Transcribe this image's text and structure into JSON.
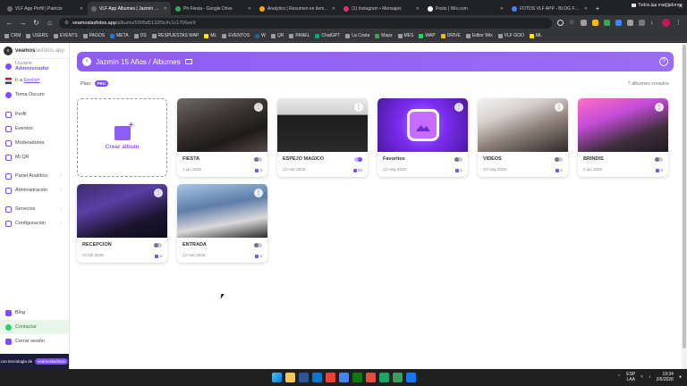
{
  "browser": {
    "tabs": [
      {
        "label": "VLF App Perfil | Patricio",
        "color": "#6b6b6b",
        "active": false
      },
      {
        "label": "VLF App Álbumes | Jazmín 15 A",
        "color": "#6b6b6b",
        "active": true
      },
      {
        "label": "Ph Fiesta - Google Drive",
        "color": "#34a853",
        "active": false
      },
      {
        "label": "Analytics | Resumen en tiempo",
        "color": "#f9ab00",
        "active": false
      },
      {
        "label": "(1) Instagram • Mensajes",
        "color": "#e1306c",
        "active": false
      },
      {
        "label": "Posts | Wix.com",
        "color": "#ffffff",
        "active": false
      },
      {
        "label": "FOTOS VLF APP - BLOG FORMA",
        "color": "#4285f4",
        "active": false
      }
    ],
    "url_host": "veamoslasfotos.app",
    "url_path": "/albums/5995d5132f9c4c1c1706ee9",
    "bookmarks": [
      {
        "label": "CRM",
        "color": "#9e9e9e"
      },
      {
        "label": "USERS",
        "color": "#9e9e9e"
      },
      {
        "label": "EVENTS",
        "color": "#9e9e9e"
      },
      {
        "label": "PAGOS",
        "color": "#9e9e9e"
      },
      {
        "label": "META",
        "color": "#1877f2"
      },
      {
        "label": "DS",
        "color": "#9e9e9e"
      },
      {
        "label": "RESPUESTAS WAP",
        "color": "#9e9e9e"
      },
      {
        "label": "ML",
        "color": "#ffe600"
      },
      {
        "label": "EVENTOS",
        "color": "#9e9e9e"
      },
      {
        "label": "W",
        "color": "#2b579a"
      },
      {
        "label": "QR",
        "color": "#9e9e9e"
      },
      {
        "label": "PANEL",
        "color": "#9e9e9e"
      },
      {
        "label": "ChatGPT",
        "color": "#10a37f"
      },
      {
        "label": "La Costa",
        "color": "#9e9e9e"
      },
      {
        "label": "Maps",
        "color": "#34a853"
      },
      {
        "label": "MES",
        "color": "#9e9e9e"
      },
      {
        "label": "WAP",
        "color": "#25d366"
      },
      {
        "label": "DRIVE",
        "color": "#fbbc04"
      },
      {
        "label": "Editor Wix",
        "color": "#9e9e9e"
      },
      {
        "label": "VLF GOO",
        "color": "#9e9e9e"
      },
      {
        "label": "ML",
        "color": "#ffe600"
      }
    ],
    "all_bookmarks": "Todos los marcadores"
  },
  "sidebar": {
    "logo": {
      "text1": "veamos",
      "text2": "lasfotos.app"
    },
    "user": {
      "prefix": "Usuario",
      "role": "Administrador"
    },
    "lang": {
      "prefix": "Ir a",
      "link": "Ennlish"
    },
    "theme": "Tema Oscuro",
    "items": [
      {
        "label": "Perfil",
        "icon": "user-icon"
      },
      {
        "label": "Eventos",
        "icon": "calendar-icon"
      },
      {
        "label": "Moderadores",
        "icon": "shield-icon"
      },
      {
        "label": "Mi QR",
        "icon": "qr-icon"
      },
      {
        "label": "Panel Analítico",
        "icon": "chart-icon"
      },
      {
        "label": "Administración",
        "icon": "admin-icon"
      },
      {
        "label": "Servicios",
        "icon": "services-icon"
      },
      {
        "label": "Configuración",
        "icon": "gear-icon"
      }
    ],
    "bottom": [
      {
        "label": "Blog",
        "icon": "blog-icon"
      },
      {
        "label": "Contactar",
        "icon": "whatsapp-icon"
      },
      {
        "label": "Cerrar sesión",
        "icon": "logout-icon"
      }
    ],
    "footer": {
      "left": "con tecnología de",
      "brand": "veamoslasfotos"
    }
  },
  "main": {
    "title": "Jazmín 15 Años / Álbumes",
    "plan_label": "Plan:",
    "plan_badge": "PRO",
    "count": "7 álbumes creados",
    "create_label": "Crear álbum",
    "accent": "#8e5cf7",
    "albums": [
      {
        "title": "FIESTA",
        "date": "1 jun 2026",
        "photos": "3",
        "enabled": false,
        "thumb": "people"
      },
      {
        "title": "ESPEJO MAGICO",
        "date": "13 mar 2026",
        "photos": "93",
        "enabled": true,
        "thumb": "dark"
      },
      {
        "title": "Favoritos",
        "date": "13 may 2026",
        "photos": "1",
        "enabled": false,
        "thumb": "purple"
      },
      {
        "title": "VIDEOS",
        "date": "23 may 2026",
        "photos": "1",
        "enabled": false,
        "thumb": "party"
      },
      {
        "title": "BRINDIS",
        "date": "2 jun 2026",
        "photos": "0",
        "enabled": false,
        "thumb": "pink"
      },
      {
        "title": "RECEPCION",
        "date": "23 feb 2026",
        "photos": "4",
        "enabled": false,
        "thumb": "purplehall"
      },
      {
        "title": "ENTRADA",
        "date": "13 mar 2026",
        "photos": "4",
        "enabled": false,
        "thumb": "blue"
      }
    ]
  },
  "taskbar": {
    "lang_top": "ESP",
    "lang_bottom": "LAA",
    "time": "19:34",
    "date": "2/6/2026",
    "apps": [
      "#f2c94c",
      "#2b579a",
      "#0078d4",
      "#ea4335",
      "#4285f4",
      "#0f7b0f",
      "#e74c3c",
      "#21a366",
      "#3a9d5d",
      "#1877f2"
    ]
  }
}
